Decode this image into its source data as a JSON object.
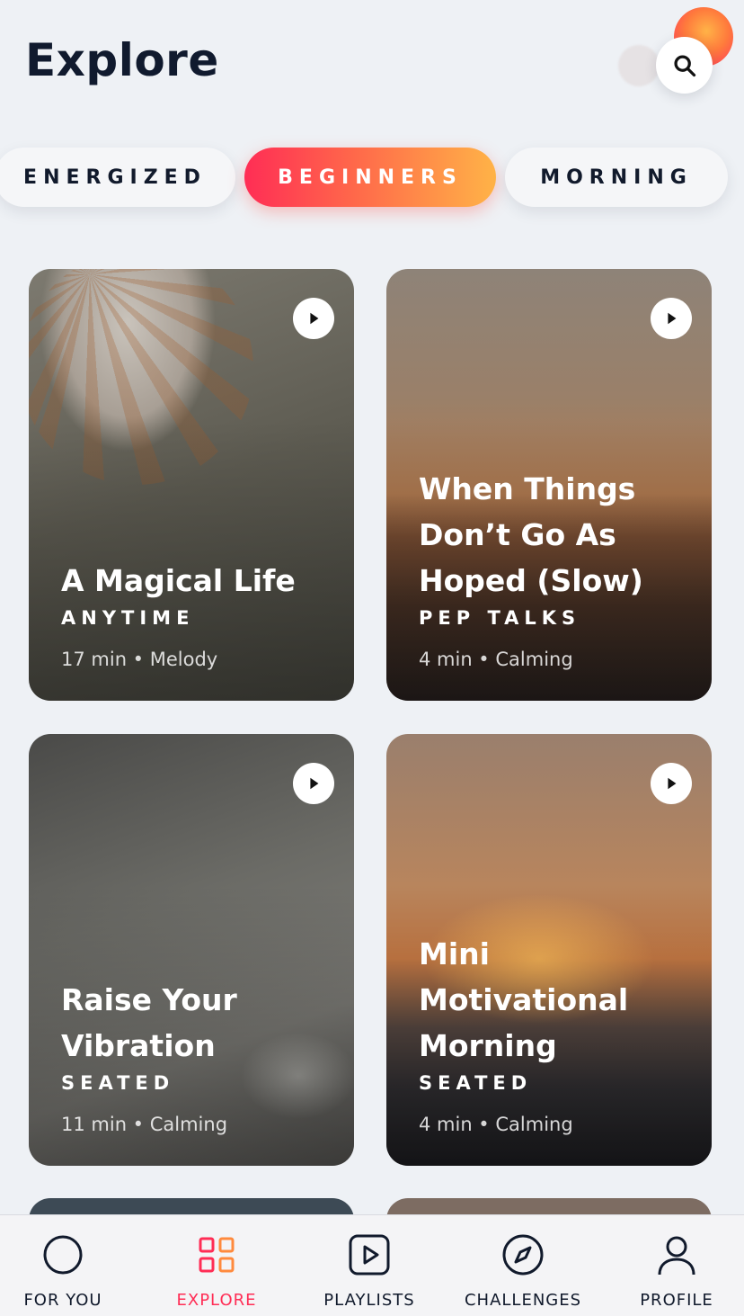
{
  "header": {
    "title": "Explore"
  },
  "chips": [
    {
      "label": "ENERGIZED",
      "active": false
    },
    {
      "label": "BEGINNERS",
      "active": true
    },
    {
      "label": "MORNING",
      "active": false
    }
  ],
  "cards": [
    {
      "title": "A Magical Life",
      "category": "ANYTIME",
      "meta": "17 min • Melody"
    },
    {
      "title": "When Things Don’t Go As Hoped (Slow)",
      "category": "PEP TALKS",
      "meta": "4 min • Calming"
    },
    {
      "title": "Raise Your Vibration",
      "category": "SEATED",
      "meta": "11 min • Calming"
    },
    {
      "title": "Mini Motivational Morning",
      "category": "SEATED",
      "meta": "4 min • Calming"
    }
  ],
  "nav": [
    {
      "label": "FOR YOU",
      "icon": "circle-icon"
    },
    {
      "label": "EXPLORE",
      "icon": "grid-icon",
      "active": true
    },
    {
      "label": "PLAYLISTS",
      "icon": "play-square-icon"
    },
    {
      "label": "CHALLENGES",
      "icon": "compass-icon"
    },
    {
      "label": "PROFILE",
      "icon": "user-icon"
    }
  ],
  "colors": {
    "accent": "#ff2d55",
    "accent_gradient_end": "#ffb347",
    "text": "#111a2c",
    "background": "#eef1f5"
  }
}
